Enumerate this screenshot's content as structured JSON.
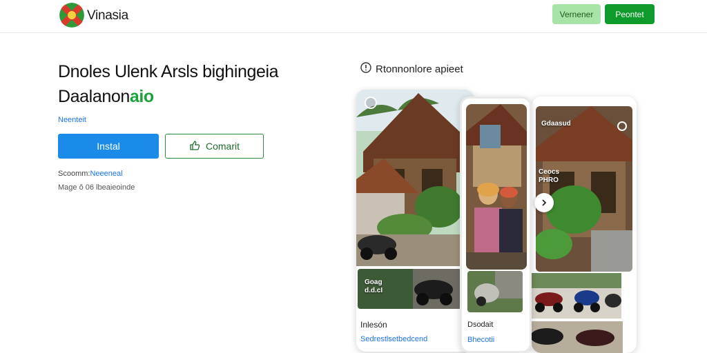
{
  "header": {
    "brand": "Vinasia",
    "logo": "flag-logo-icon",
    "secondary_button": "Vernener",
    "primary_button": "Peontet"
  },
  "hero": {
    "title_line1": "Dnoles Ulenk Arsls bighingeia",
    "title_line2": "Daalanon",
    "title_accent": "aio",
    "publisher": "Neenteit",
    "install_label": "Instal",
    "comment_label": "Comarit",
    "comment_icon": "thumbs-up-icon",
    "meta_prefix": "Scoomm:",
    "meta_highlight": "Neeeneal",
    "meta_line2": "Mage ô 06 lbeaieoinde"
  },
  "preview": {
    "label": "Rtonnonlore apieet",
    "label_icon": "location-pin-icon",
    "card1": {
      "overlay_text": "Goag\nd.d.cI",
      "caption": "Inlesón",
      "link": "Sedrestlsetbedcend"
    },
    "card2": {
      "caption": "Dsodait",
      "link": "Bhecotii"
    },
    "card3": {
      "top_text": "Gdaasud",
      "side_text": "Ceocs\nPHRO",
      "next_icon": "chevron-right-icon"
    }
  },
  "colors": {
    "accent_green": "#0e9b2c",
    "install_blue": "#1a8be8",
    "link_blue": "#1a73e8"
  }
}
